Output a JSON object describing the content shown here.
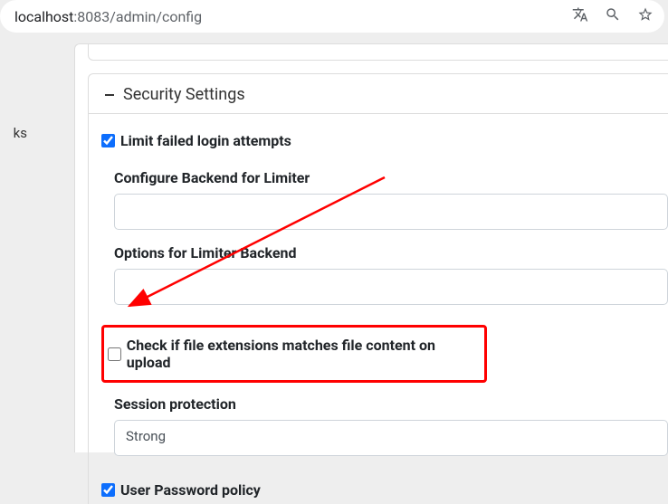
{
  "address_bar": {
    "host": "localhost",
    "port_path": ":8083/admin/config"
  },
  "sidebar": {
    "fragment": "ks"
  },
  "section": {
    "title": "Security Settings"
  },
  "options": {
    "limit_login": {
      "label": "Limit failed login attempts",
      "checked": true
    },
    "configure_backend": {
      "label": "Configure Backend for Limiter",
      "value": ""
    },
    "limiter_options": {
      "label": "Options for Limiter Backend",
      "value": ""
    },
    "check_extensions": {
      "label": "Check if file extensions matches file content on upload",
      "checked": false
    },
    "session_protection": {
      "label": "Session protection",
      "value": "Strong"
    },
    "password_policy": {
      "label": "User Password policy",
      "checked": true
    }
  }
}
